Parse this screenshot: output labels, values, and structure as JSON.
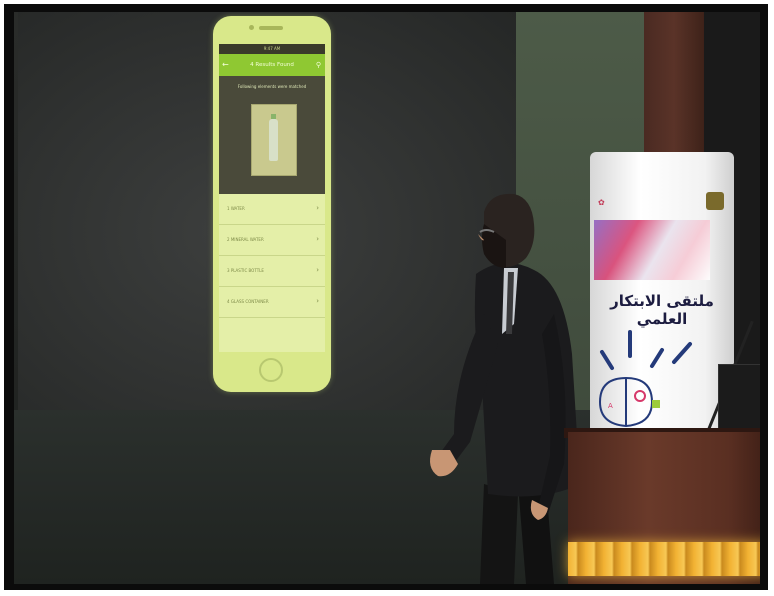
{
  "phone_app": {
    "header_title": "4 Results Found",
    "status_time": "9:47 AM",
    "match_message": "Following elements were matched",
    "results": [
      {
        "label": "1  WATER"
      },
      {
        "label": "2  MINERAL WATER"
      },
      {
        "label": "3  PLASTIC BOTTLE"
      },
      {
        "label": "4  GLASS CONTAINER"
      }
    ]
  },
  "banner": {
    "arabic_title": "ملتقى الابتكار العلمي"
  },
  "colors": {
    "app_accent": "#8fc832",
    "phone_glow": "#d9e88a",
    "podium_light": "#f2b233"
  }
}
